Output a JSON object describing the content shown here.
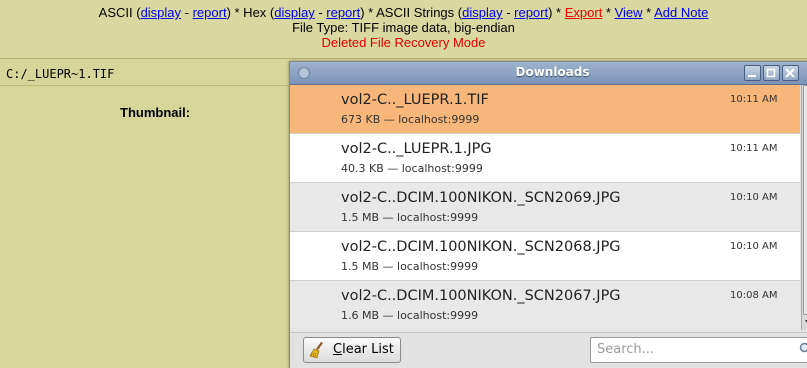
{
  "header": {
    "ascii_label": "ASCII (",
    "ascii_display": "display",
    "ascii_sep": " - ",
    "ascii_report": "report",
    "hex_label": ") * Hex (",
    "hex_display": "display",
    "hex_sep": " - ",
    "hex_report": "report",
    "strings_label": ") * ASCII Strings (",
    "strings_display": "display",
    "strings_sep": " - ",
    "strings_report": "report",
    "after_strings": ") * ",
    "export": "Export",
    "star1": " * ",
    "view": "View",
    "star2": " * ",
    "add_note": "Add Note",
    "file_type": "File Type: TIFF image data, big-endian",
    "mode": "Deleted File Recovery Mode"
  },
  "left_panel": {
    "path": "C:/_LUEPR~1.TIF",
    "thumbnail_label": "Thumbnail:"
  },
  "downloads_window": {
    "title": "Downloads",
    "items": [
      {
        "name": "vol2-C.._LUEPR.1.TIF",
        "meta": "673 KB — localhost:9999",
        "time": "10:11 AM",
        "selected": true
      },
      {
        "name": "vol2-C.._LUEPR.1.JPG",
        "meta": "40.3 KB — localhost:9999",
        "time": "10:11 AM",
        "selected": false
      },
      {
        "name": "vol2-C..DCIM.100NIKON._SCN2069.JPG",
        "meta": "1.5 MB — localhost:9999",
        "time": "10:10 AM",
        "selected": false
      },
      {
        "name": "vol2-C..DCIM.100NIKON._SCN2068.JPG",
        "meta": "1.5 MB — localhost:9999",
        "time": "10:10 AM",
        "selected": false
      },
      {
        "name": "vol2-C..DCIM.100NIKON._SCN2067.JPG",
        "meta": "1.6 MB — localhost:9999",
        "time": "10:08 AM",
        "selected": false
      }
    ],
    "clear_list_accel": "C",
    "clear_list_rest": "lear List",
    "search_placeholder": "Search..."
  },
  "colors": {
    "page_bg": "#d6d69a",
    "selected_row": "#f7b77a",
    "link": "#0000ee",
    "mode_text": "#e00000"
  }
}
